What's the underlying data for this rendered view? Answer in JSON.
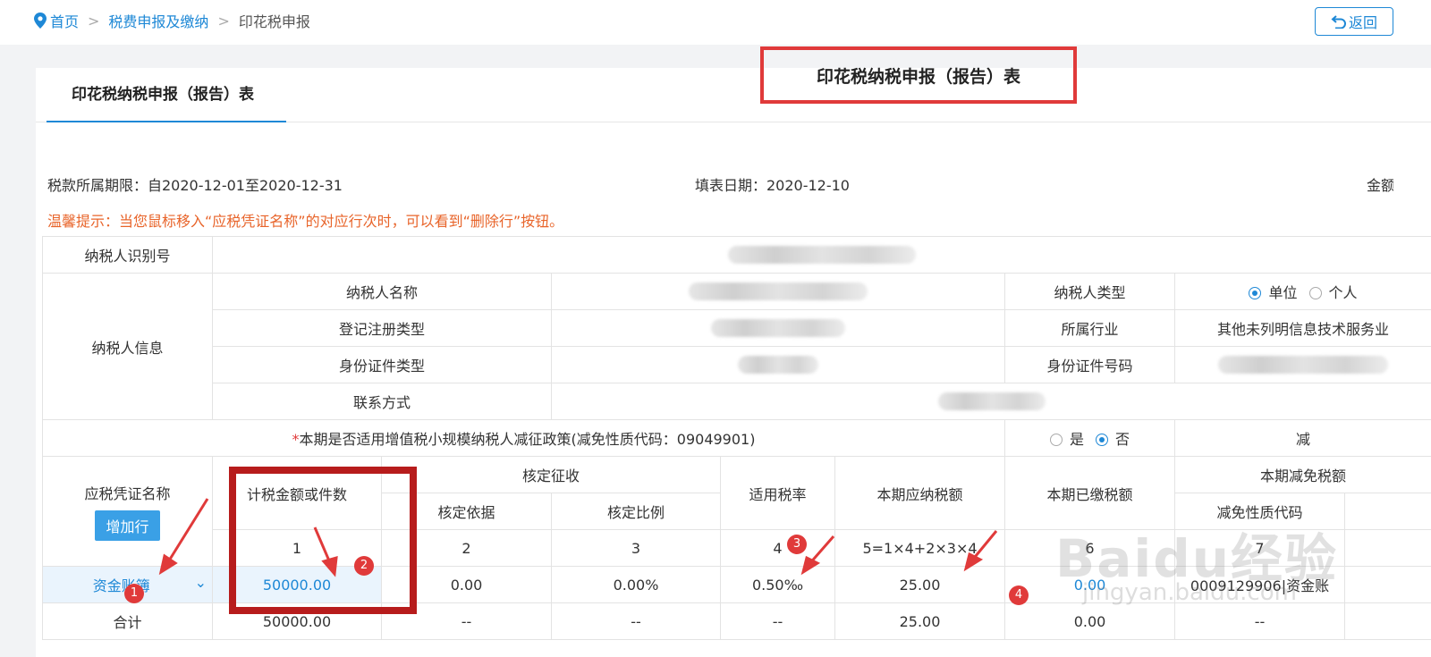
{
  "breadcrumb": {
    "home": "首页",
    "level1": "税费申报及缴纳",
    "current": "印花税申报"
  },
  "back_label": "返回",
  "tab_label": "印花税纳税申报（报告）表",
  "form_title": "印花税纳税申报（报告）表",
  "meta": {
    "period": "税款所属期限：自2020-12-01至2020-12-31",
    "fill_date": "填表日期：2020-12-10",
    "amount_unit": "金额"
  },
  "tip": "温馨提示：当您鼠标移入“应税凭证名称”的对应行次时，可以看到“删除行”按钮。",
  "taxpayer": {
    "id_label": "纳税人识别号",
    "info_label": "纳税人信息",
    "name_label": "纳税人名称",
    "reg_type_label": "登记注册类型",
    "id_type_label": "身份证件类型",
    "contact_label": "联系方式",
    "type_label": "纳税人类型",
    "type_opt1": "单位",
    "type_opt2": "个人",
    "industry_label": "所属行业",
    "industry_value": "其他未列明信息技术服务业",
    "id_no_label": "身份证件号码"
  },
  "policy": {
    "star": "*",
    "text": "本期是否适用增值税小规模纳税人减征政策(减免性质代码：09049901)",
    "yes": "是",
    "no": "否",
    "right_label": "减"
  },
  "headers": {
    "doc_name": "应税凭证名称",
    "add_row": "增加行",
    "taxable_amount": "计税金额或件数",
    "assessed": "核定征收",
    "assessed_basis": "核定依据",
    "assessed_ratio": "核定比例",
    "rate": "适用税率",
    "payable": "本期应纳税额",
    "paid": "本期已缴税额",
    "relief": "本期减免税额",
    "relief_code": "减免性质代码"
  },
  "index_row": [
    "1",
    "2",
    "3",
    "4",
    "5=1×4+2×3×4",
    "6",
    "7"
  ],
  "data_row": {
    "doc_name": "资金账簿",
    "amount": "50000.00",
    "basis": "0.00",
    "ratio": "0.00%",
    "rate": "0.50‰",
    "payable": "25.00",
    "paid": "0.00",
    "code": "0009129906|资金账"
  },
  "total_row": {
    "label": "合计",
    "amount": "50000.00",
    "basis": "--",
    "ratio": "--",
    "rate": "--",
    "payable": "25.00",
    "paid": "0.00",
    "code": "--"
  },
  "badges": [
    "1",
    "2",
    "3",
    "4"
  ],
  "watermark": {
    "main": "Baidu经验",
    "sub": "jingyan.baidu.com"
  },
  "colors": {
    "accent": "#1e88d6",
    "warning": "#e8642a",
    "highlight": "#e03a3a"
  }
}
